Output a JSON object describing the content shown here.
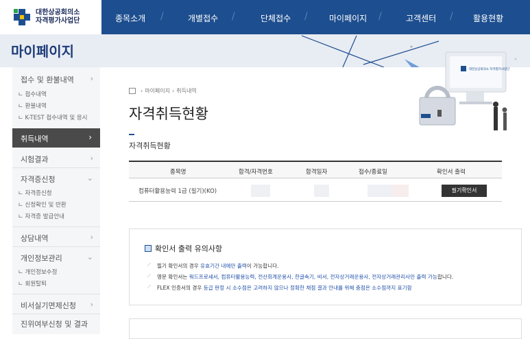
{
  "logo": {
    "line1": "대한상공회의소",
    "line2": "자격평가사업단"
  },
  "gnb": [
    "종목소개",
    "개별접수",
    "단체접수",
    "마이페이지",
    "고객센터",
    "활용현황"
  ],
  "subheader": {
    "title": "마이페이지",
    "banner_logo_text": "대한상공회의소 자격평가사업단"
  },
  "sidebar": {
    "menus": [
      {
        "label": "접수 및 환불내역",
        "subs": [
          "접수내역",
          "환불내역",
          "K-TEST 접수내역 및 응시"
        ]
      },
      {
        "label": "취득내역",
        "active": true
      },
      {
        "label": "시험결과"
      },
      {
        "label": "자격증신청",
        "subs": [
          "자격증신청",
          "신청확인 및 반환",
          "자격증 발급안내"
        ]
      },
      {
        "label": "상담내역"
      },
      {
        "label": "개인정보관리",
        "subs": [
          "개인정보수정",
          "회원탈퇴"
        ]
      },
      {
        "label": "비서실기면제신청"
      },
      {
        "label": "진위여부신청 및 결과"
      }
    ]
  },
  "breadcrumb": {
    "items": [
      "마이페이지",
      "취득내역"
    ]
  },
  "page_title": "자격취득현황",
  "section_title": "자격취득현황",
  "table": {
    "headers": [
      "종목명",
      "합격/자격번호",
      "합격일자",
      "접수/종료일",
      "확인서 출력"
    ],
    "rows": [
      {
        "subject": "컴퓨터활용능력 1급 (필기)(KO)",
        "button": "필기확인서"
      }
    ]
  },
  "notice": {
    "title": "확인서 출력 유의사항",
    "lines": [
      {
        "parts": [
          "필기 확인서의 경우 ",
          "유효기간 내에만 출력",
          "이 가능합니다."
        ]
      },
      {
        "parts": [
          "영문 확인서는 ",
          "워드프로세서, 컴퓨터활용능력, 전산회계운용사, 한글속기, 비서, 전자상거래운용사, 전자상거래관리사만 출력 가능",
          "합니다."
        ]
      },
      {
        "parts": [
          "FLEX 인증서의 경우 ",
          "등급 판정 시 소수점은 고려하지 않으나 정확한 채점 결과 안내를 위해 충점은 소수점까지 표기함",
          ""
        ]
      }
    ]
  },
  "colors": {
    "gnb_bg": "#1d4e8f",
    "title_blue": "#1d3c78",
    "link_blue": "#1d4ea8",
    "sidebar_active": "#4a4a4a"
  }
}
